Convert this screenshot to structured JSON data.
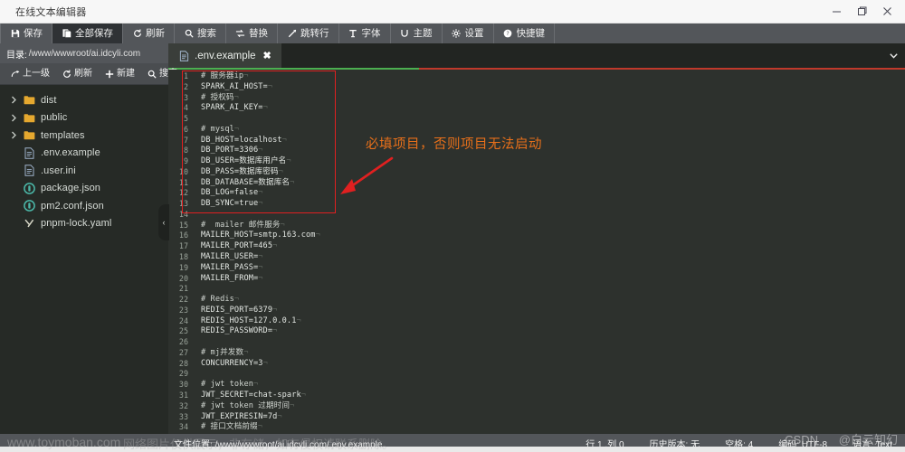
{
  "window": {
    "title": "在线文本编辑器",
    "controls": [
      {
        "name": "minimize",
        "glyph": "minimize-icon"
      },
      {
        "name": "maximize",
        "glyph": "maximize-icon"
      },
      {
        "name": "close",
        "glyph": "close-icon"
      }
    ]
  },
  "toolbar": {
    "items": [
      {
        "label": "保存",
        "icon": "save-icon",
        "active": false
      },
      {
        "label": "全部保存",
        "icon": "save-all-icon",
        "active": true
      },
      {
        "label": "刷新",
        "icon": "refresh-icon",
        "active": false
      },
      {
        "label": "搜索",
        "icon": "search-icon",
        "active": false
      },
      {
        "label": "替换",
        "icon": "replace-icon",
        "active": false
      },
      {
        "label": "跳转行",
        "icon": "goto-line-icon",
        "active": false
      },
      {
        "label": "字体",
        "icon": "font-icon",
        "active": false
      },
      {
        "label": "主题",
        "icon": "theme-icon",
        "active": false
      },
      {
        "label": "设置",
        "icon": "gear-icon",
        "active": false
      },
      {
        "label": "快捷键",
        "icon": "keyboard-shortcut-icon",
        "active": false
      }
    ]
  },
  "sidebar": {
    "dir_label": "目录:",
    "dir_path": "/www/wwwroot/ai.idcyli.com",
    "actions": [
      {
        "label": "上一级",
        "icon": "arrow-up-level-icon"
      },
      {
        "label": "刷新",
        "icon": "refresh-icon"
      },
      {
        "label": "新建",
        "icon": "plus-icon"
      },
      {
        "label": "搜索",
        "icon": "search-icon"
      }
    ],
    "tree": [
      {
        "name": "dist",
        "type": "folder",
        "expandable": true
      },
      {
        "name": "public",
        "type": "folder",
        "expandable": true
      },
      {
        "name": "templates",
        "type": "folder",
        "expandable": true
      },
      {
        "name": ".env.example",
        "type": "file",
        "expandable": false
      },
      {
        "name": ".user.ini",
        "type": "file",
        "expandable": false
      },
      {
        "name": "package.json",
        "type": "json",
        "expandable": false
      },
      {
        "name": "pm2.conf.json",
        "type": "json",
        "expandable": false
      },
      {
        "name": "pnpm-lock.yaml",
        "type": "yaml",
        "expandable": false
      }
    ],
    "collapse_handle": "‹"
  },
  "tabs": {
    "items": [
      {
        "label": ".env.example",
        "icon": "file-icon",
        "close": "✖",
        "active": true
      }
    ],
    "overflow_chevron": "chevron-down-icon",
    "progress": {
      "done_pct": 34,
      "done_color": "#4caf50",
      "rest_color": "#c0392b"
    }
  },
  "editor": {
    "lines": [
      {
        "n": 1,
        "text": "# 服务器ip",
        "comment": true
      },
      {
        "n": 2,
        "text": "SPARK_AI_HOST=",
        "comment": false
      },
      {
        "n": 3,
        "text": "# 授权码",
        "comment": true
      },
      {
        "n": 4,
        "text": "SPARK_AI_KEY=",
        "comment": false
      },
      {
        "n": 5,
        "text": "",
        "comment": false
      },
      {
        "n": 6,
        "text": "# mysql",
        "comment": true
      },
      {
        "n": 7,
        "text": "DB_HOST=localhost",
        "comment": false
      },
      {
        "n": 8,
        "text": "DB_PORT=3306",
        "comment": false
      },
      {
        "n": 9,
        "text": "DB_USER=数据库用户名",
        "comment": false
      },
      {
        "n": 10,
        "text": "DB_PASS=数据库密码",
        "comment": false
      },
      {
        "n": 11,
        "text": "DB_DATABASE=数据库名",
        "comment": false
      },
      {
        "n": 12,
        "text": "DB_LOG=false",
        "comment": false
      },
      {
        "n": 13,
        "text": "DB_SYNC=true",
        "comment": false
      },
      {
        "n": 14,
        "text": "",
        "comment": false
      },
      {
        "n": 15,
        "text": "#  mailer 邮件服务",
        "comment": true
      },
      {
        "n": 16,
        "text": "MAILER_HOST=smtp.163.com",
        "comment": false
      },
      {
        "n": 17,
        "text": "MAILER_PORT=465",
        "comment": false
      },
      {
        "n": 18,
        "text": "MAILER_USER=",
        "comment": false
      },
      {
        "n": 19,
        "text": "MAILER_PASS=",
        "comment": false
      },
      {
        "n": 20,
        "text": "MAILER_FROM=",
        "comment": false
      },
      {
        "n": 21,
        "text": "",
        "comment": false
      },
      {
        "n": 22,
        "text": "# Redis",
        "comment": true
      },
      {
        "n": 23,
        "text": "REDIS_PORT=6379",
        "comment": false
      },
      {
        "n": 24,
        "text": "REDIS_HOST=127.0.0.1",
        "comment": false
      },
      {
        "n": 25,
        "text": "REDIS_PASSWORD=",
        "comment": false
      },
      {
        "n": 26,
        "text": "",
        "comment": false
      },
      {
        "n": 27,
        "text": "# mj并发数",
        "comment": true
      },
      {
        "n": 28,
        "text": "CONCURRENCY=3",
        "comment": false
      },
      {
        "n": 29,
        "text": "",
        "comment": false
      },
      {
        "n": 30,
        "text": "# jwt token",
        "comment": true
      },
      {
        "n": 31,
        "text": "JWT_SECRET=chat-spark",
        "comment": false
      },
      {
        "n": 32,
        "text": "# jwt token 过期时间",
        "comment": true
      },
      {
        "n": 33,
        "text": "JWT_EXPIRESIN=7d",
        "comment": false
      },
      {
        "n": 34,
        "text": "# 接口文档前缀",
        "comment": true
      }
    ]
  },
  "annotation": {
    "text": "必填项目，否则项目无法启动",
    "color": "#e8701a",
    "highlight_color": "#e02020",
    "arrow_color": "#e02020"
  },
  "statusbar": {
    "file_label": "文件位置:",
    "file_path": "/www/wwwroot/ai.idcyli.com/.env.example",
    "items": [
      "行 1 ,列 0",
      "历史版本: 无",
      "空格: 4",
      "编码: UTF-8",
      "语言: Text"
    ]
  },
  "watermarks": {
    "toymoban": "www.toymoban.com",
    "notice": "网络图片仅供展示，非存储，如有侵权请联系删除。",
    "csdn": "CSDN",
    "cn": "@白云知幻"
  }
}
